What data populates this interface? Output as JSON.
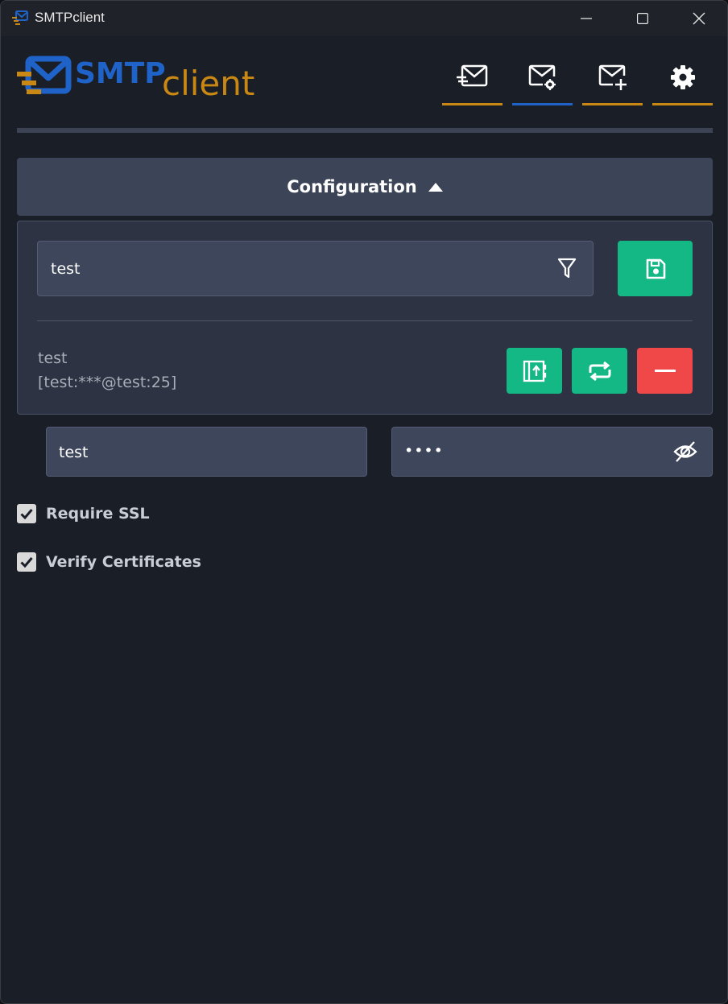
{
  "window": {
    "title": "SMTPclient",
    "controls": [
      "minimize-icon",
      "maximize-icon",
      "close-icon"
    ]
  },
  "logo": {
    "primary": "SMTP",
    "secondary": "client"
  },
  "nav": {
    "items": [
      {
        "icon": "send-mail-icon",
        "active": false
      },
      {
        "icon": "mail-settings-icon",
        "active": true
      },
      {
        "icon": "mail-add-icon",
        "active": false
      },
      {
        "icon": "gear-icon",
        "active": false
      }
    ]
  },
  "config": {
    "title": "Configuration",
    "expand_icon": "caret-up-icon",
    "filter_value": "test",
    "entry": {
      "name": "test",
      "detail": "[test:***@test:25]"
    }
  },
  "credentials": {
    "username": "test",
    "password_mask": "••••"
  },
  "options": {
    "require_ssl": {
      "label": "Require SSL",
      "checked": true
    },
    "verify_certificates": {
      "label": "Verify Certificates",
      "checked": true
    }
  },
  "colors": {
    "accent_orange": "#c98713",
    "accent_blue": "#1f63c9",
    "success": "#13b884",
    "danger": "#f04848"
  }
}
